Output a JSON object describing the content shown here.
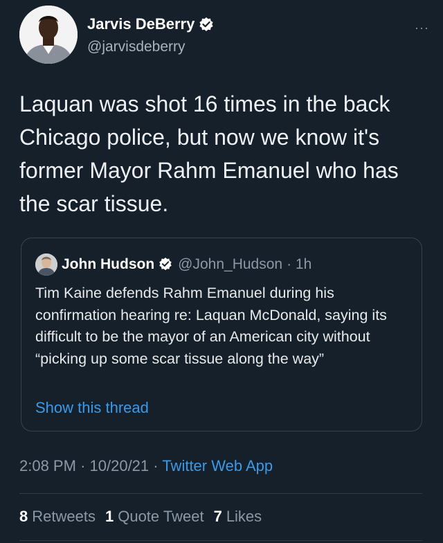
{
  "author": {
    "name": "Jarvis DeBerry",
    "handle": "@jarvisdeberry"
  },
  "more_icon": "···",
  "tweet": {
    "text": "Laquan was shot 16 times in the back Chicago police, but now we know it's former Mayor Rahm Emanuel who has the scar tissue."
  },
  "quote": {
    "name": "John Hudson",
    "handle": "@John_Hudson",
    "time": "· 1h",
    "text": "Tim Kaine defends Rahm Emanuel during his confirmation hearing re: Laquan McDonald, saying its difficult to be the mayor of an American city without “picking up some scar tissue along the way”",
    "show_thread": "Show this thread"
  },
  "meta": {
    "time": "2:08 PM",
    "date": "10/20/21",
    "sep": "·",
    "app": "Twitter Web App"
  },
  "stats": {
    "retweets_count": "8",
    "retweets_label": "Retweets",
    "quotes_count": "1",
    "quotes_label": "Quote Tweet",
    "likes_count": "7",
    "likes_label": "Likes"
  },
  "colors": {
    "background": "#15202b",
    "link": "#3b9ae8",
    "verified": "#ffffff"
  }
}
